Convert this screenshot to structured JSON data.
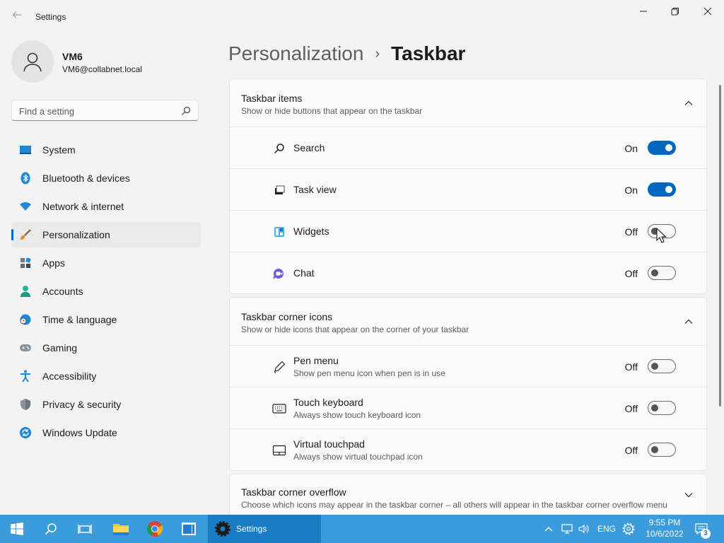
{
  "window": {
    "title": "Settings"
  },
  "profile": {
    "name": "VM6",
    "email": "VM6@collabnet.local"
  },
  "search": {
    "placeholder": "Find a setting"
  },
  "sidebar": {
    "items": [
      {
        "label": "System",
        "icon": "system-icon"
      },
      {
        "label": "Bluetooth & devices",
        "icon": "bluetooth-icon"
      },
      {
        "label": "Network & internet",
        "icon": "network-icon"
      },
      {
        "label": "Personalization",
        "icon": "brush-icon",
        "active": true
      },
      {
        "label": "Apps",
        "icon": "apps-icon"
      },
      {
        "label": "Accounts",
        "icon": "accounts-icon"
      },
      {
        "label": "Time & language",
        "icon": "clock-globe-icon"
      },
      {
        "label": "Gaming",
        "icon": "gamepad-icon"
      },
      {
        "label": "Accessibility",
        "icon": "accessibility-icon"
      },
      {
        "label": "Privacy & security",
        "icon": "shield-icon"
      },
      {
        "label": "Windows Update",
        "icon": "update-icon"
      }
    ]
  },
  "breadcrumb": {
    "parent": "Personalization",
    "separator": "›",
    "current": "Taskbar"
  },
  "sections": [
    {
      "title": "Taskbar items",
      "subtitle": "Show or hide buttons that appear on the taskbar",
      "expanded": true,
      "rows": [
        {
          "label": "Search",
          "state": "On",
          "on": true,
          "icon": "search-icon"
        },
        {
          "label": "Task view",
          "state": "On",
          "on": true,
          "icon": "task-view-icon"
        },
        {
          "label": "Widgets",
          "state": "Off",
          "on": false,
          "icon": "widgets-icon"
        },
        {
          "label": "Chat",
          "state": "Off",
          "on": false,
          "icon": "chat-icon"
        }
      ]
    },
    {
      "title": "Taskbar corner icons",
      "subtitle": "Show or hide icons that appear on the corner of your taskbar",
      "expanded": true,
      "rows": [
        {
          "label": "Pen menu",
          "sub": "Show pen menu icon when pen is in use",
          "state": "Off",
          "on": false,
          "icon": "pen-icon"
        },
        {
          "label": "Touch keyboard",
          "sub": "Always show touch keyboard icon",
          "state": "Off",
          "on": false,
          "icon": "keyboard-icon"
        },
        {
          "label": "Virtual touchpad",
          "sub": "Always show virtual touchpad icon",
          "state": "Off",
          "on": false,
          "icon": "touchpad-icon"
        }
      ]
    },
    {
      "title": "Taskbar corner overflow",
      "subtitle": "Choose which icons may appear in the taskbar corner – all others will appear in the taskbar corner overflow menu",
      "expanded": false
    }
  ],
  "taskbar": {
    "active_app": "Settings",
    "language": "ENG",
    "time": "9:55 PM",
    "date": "10/6/2022",
    "notification_count": "3",
    "color": "#3c9cdb"
  },
  "colors": {
    "accent": "#0067c0",
    "background": "#f3f3f3",
    "card": "#fbfbfb"
  }
}
